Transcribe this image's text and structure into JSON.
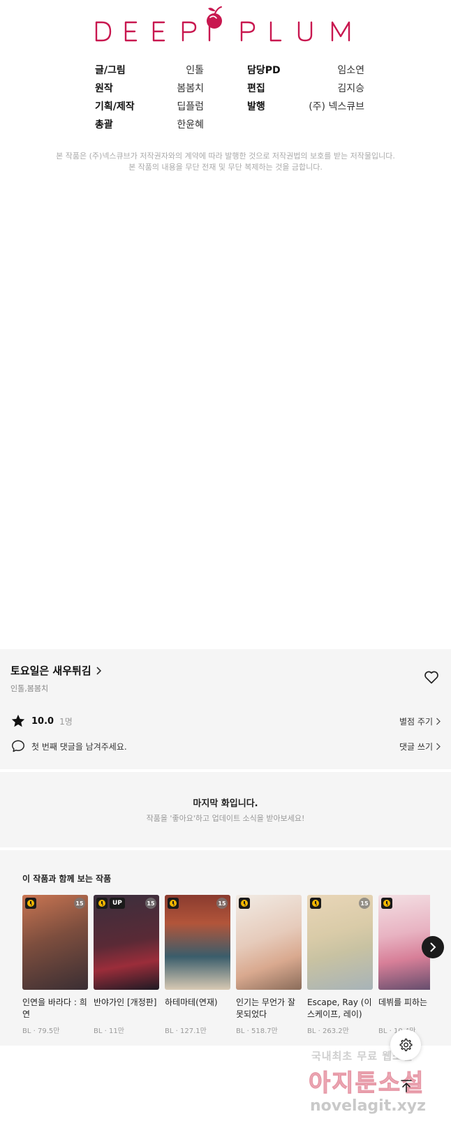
{
  "logo": {
    "text": "DEEPPLUM",
    "brand_color": "#c8174f"
  },
  "credits": [
    {
      "role": "글/그림",
      "name": "인톨"
    },
    {
      "role": "담당PD",
      "name": "임소연"
    },
    {
      "role": "원작",
      "name": "봄봄치"
    },
    {
      "role": "편집",
      "name": "김지승"
    },
    {
      "role": "기획/제작",
      "name": "딥플럼"
    },
    {
      "role": "발행",
      "name": "(주) 넥스큐브"
    },
    {
      "role": "총괄",
      "name": "한윤혜"
    }
  ],
  "copyright": {
    "line1": "본 작품은 (주)넥스큐브가 저작권자와의 계약에 따라 발행한 것으로 저작권법의 보호를 받는 저작물입니다.",
    "line2": "본 작품의 내용을 무단 전재 및 무단 복제하는 것을 금합니다."
  },
  "work": {
    "title": "토요일은 새우튀김",
    "authors": "인톨,봄봄치",
    "rating": "10.0",
    "rating_count": "1명",
    "rate_link": "별점 주기",
    "comment_prompt": "첫 번째 댓글을 남겨주세요.",
    "comment_link": "댓글 쓰기"
  },
  "last_episode": {
    "title": "마지막 화입니다.",
    "subtitle": "작품을 '좋아요'하고 업데이트 소식을 받아보세요!"
  },
  "recommendations": {
    "heading": "이 작품과 함께 보는 작품",
    "items": [
      {
        "title": "인연을 바라다 : 희연",
        "genre": "BL",
        "views": "79.5만",
        "age": "15",
        "up": "",
        "art": [
          "#7d4e3e",
          "#c97552",
          "#3a2e33"
        ]
      },
      {
        "title": "반야가인 [개정판]",
        "genre": "BL",
        "views": "11만",
        "age": "15",
        "up": "UP",
        "art": [
          "#3b2f3d",
          "#9b2d3a",
          "#1e1a24"
        ]
      },
      {
        "title": "하테마테(연재)",
        "genre": "BL",
        "views": "127.1만",
        "age": "15",
        "up": "",
        "art": [
          "#8a3b2f",
          "#3a5d6b",
          "#d8c9b3"
        ]
      },
      {
        "title": "인기는 무언가 잘못되었다",
        "genre": "BL",
        "views": "518.7만",
        "age": "",
        "up": "",
        "art": [
          "#f1ebe4",
          "#d9a98f",
          "#8a6c5a"
        ]
      },
      {
        "title": "Escape, Ray (이스케이프, 레이)",
        "genre": "BL",
        "views": "263.2만",
        "age": "15",
        "up": "",
        "art": [
          "#e9d6b8",
          "#c8c2a2",
          "#a7b3b8"
        ]
      },
      {
        "title": "데뷔를 피하는 법",
        "genre": "BL",
        "views": "10.4만",
        "age": "",
        "up": "",
        "art": [
          "#f3dfe3",
          "#d77f98",
          "#5e4a6a"
        ]
      }
    ]
  },
  "watermark": {
    "line1": "국내최초 무료 웹소설",
    "line2": "아지툰소설",
    "line3": "novelagit.xyz"
  }
}
